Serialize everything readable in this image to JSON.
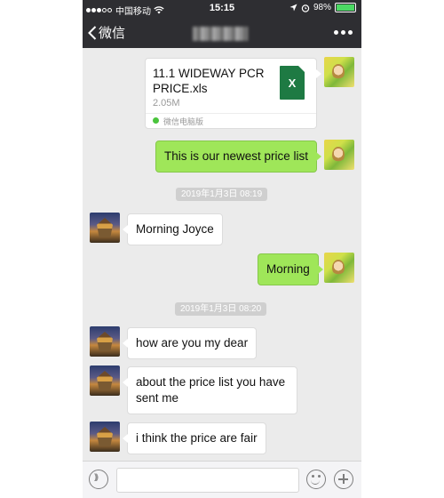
{
  "status_bar": {
    "carrier": "中国移动",
    "time": "15:15",
    "battery": "98%",
    "battery_level": 0.98,
    "icons": [
      "signal-dots-icon",
      "wifi-icon",
      "location-arrow-icon",
      "alarm-icon",
      "battery-icon"
    ]
  },
  "nav": {
    "back_label": "微信",
    "more_icon": "more-dots-icon"
  },
  "messages": {
    "file": {
      "name": "11.1 WIDEWAY PCR PRICE.xls",
      "size": "2.05M",
      "source": "微信电脑版",
      "icon_letter": "X"
    },
    "m1": "This is our newest price list",
    "time1": "2019年1月3日 08:19",
    "m2": "Morning Joyce",
    "m3": "Morning",
    "time2": "2019年1月3日 08:20",
    "m4": "how are you my dear",
    "m5": "about the price list you have sent me",
    "m6": "i think the price are fair"
  },
  "input_bar": {
    "icons": [
      "voice-icon",
      "emoji-icon",
      "plus-icon"
    ]
  },
  "colors": {
    "bar_bg": "#2e2e32",
    "chat_bg": "#ebebeb",
    "outgoing_bubble": "#9fe659",
    "incoming_bubble": "#ffffff",
    "excel_green": "#1e7a43"
  }
}
